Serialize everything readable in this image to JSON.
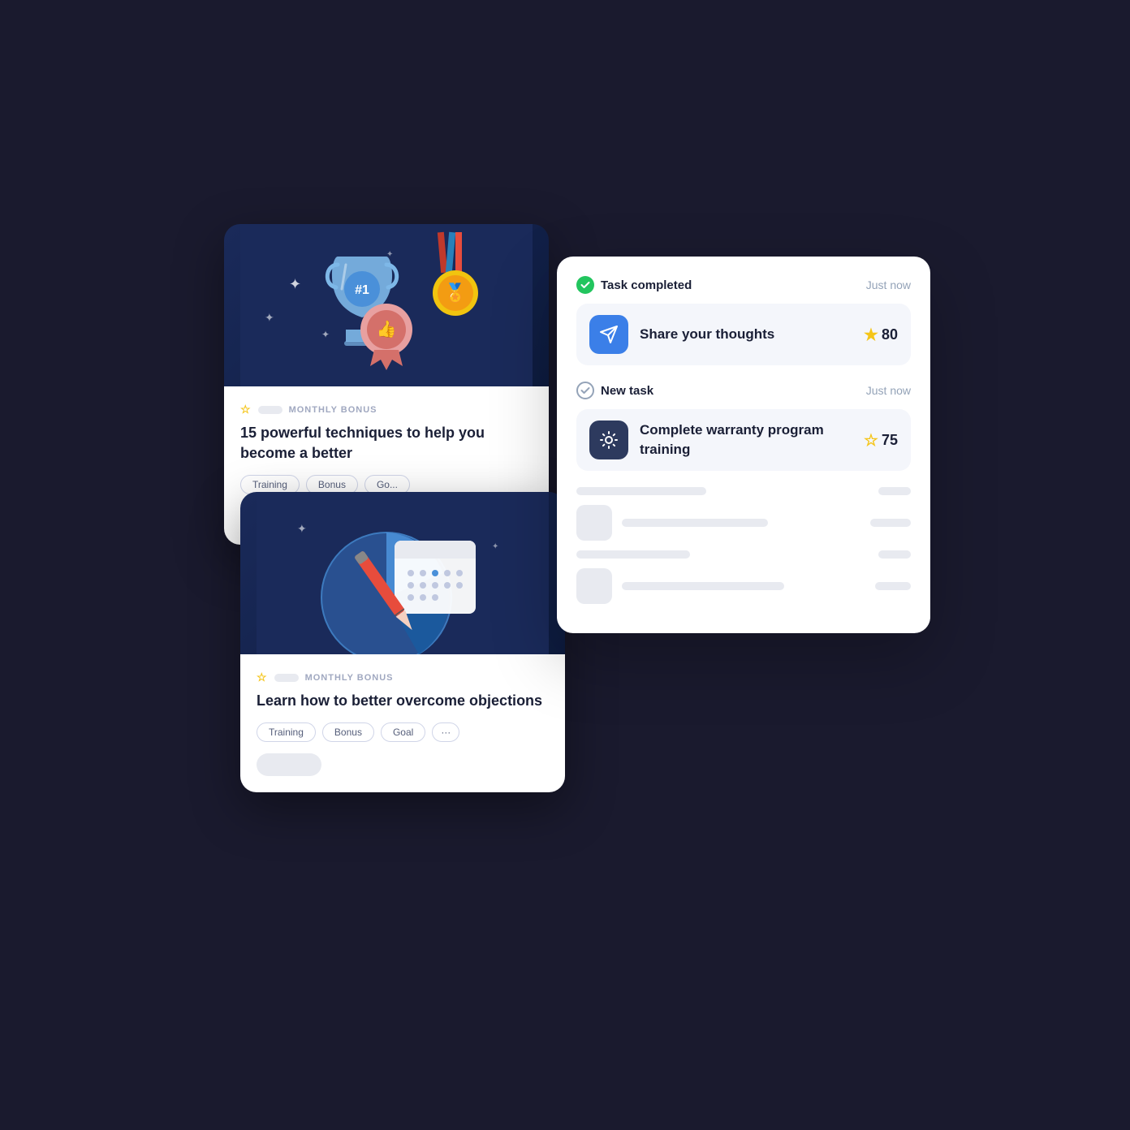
{
  "scene": {
    "background": "#0f1629"
  },
  "card_top": {
    "badge": "MONTHLY BONUS",
    "title": "15 powerful techniques to help you become a better",
    "tags": [
      "Training",
      "Bonus",
      "Go..."
    ]
  },
  "card_bottom": {
    "badge": "MONTHLY BONUS",
    "title": "Learn how to better overcome objections",
    "tags": [
      "Training",
      "Bonus",
      "Goal",
      "···"
    ]
  },
  "notification_card": {
    "section1": {
      "status_label": "Task completed",
      "time": "Just now",
      "task_title": "Share your thoughts",
      "task_points": "80"
    },
    "section2": {
      "status_label": "New task",
      "time": "Just now",
      "task_title": "Complete warranty program training",
      "task_points": "75"
    }
  }
}
